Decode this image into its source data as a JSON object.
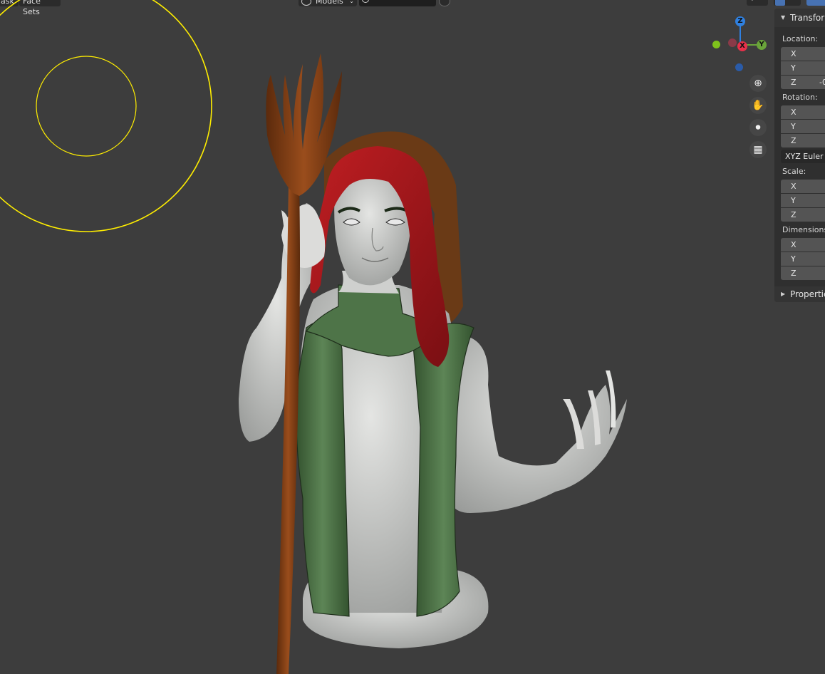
{
  "header": {
    "mask_label": "ask",
    "face_sets_label": "Face Sets",
    "collection_dropdown": "Models",
    "search_value": ""
  },
  "nav": {
    "gizmo": {
      "z": "Z",
      "x": "X",
      "y": "Y"
    },
    "zoom_icon": "zoom-icon",
    "pan_icon": "hand-icon",
    "camera_icon": "camera-icon",
    "ortho_icon": "grid-icon"
  },
  "npanel": {
    "tab_title": "Transform",
    "location": {
      "label": "Location:",
      "x": "X",
      "y": "Y",
      "z": "Z",
      "z_value_partial": "-0"
    },
    "rotation": {
      "label": "Rotation:",
      "x": "X",
      "y": "Y",
      "z": "Z"
    },
    "rotation_mode": "XYZ Euler",
    "scale": {
      "label": "Scale:",
      "x": "X",
      "y": "Y",
      "z": "Z"
    },
    "dimensions": {
      "label": "Dimensions:",
      "x": "X",
      "y": "Y",
      "z": "Z"
    },
    "properties_label": "Properties"
  },
  "colors": {
    "viewport_bg": "#3d3d3d",
    "brush_circle": "#ffee00",
    "cloth_green": "#4e7448",
    "skin": "#c6c8c6",
    "hair_red": "#a0161c",
    "staff_brown": "#7a3a12",
    "axis_x": "#e8304a",
    "axis_y": "#6aa43a",
    "axis_z": "#2f80e0"
  }
}
